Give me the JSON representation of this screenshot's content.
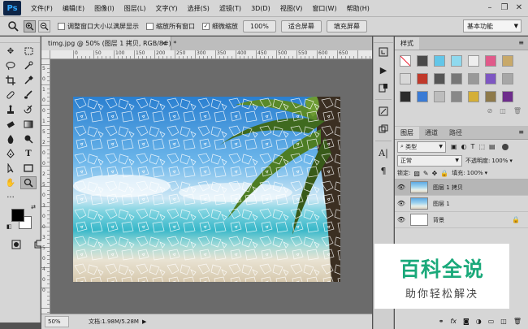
{
  "app": {
    "logo": "Ps"
  },
  "menu": [
    "文件(F)",
    "编辑(E)",
    "图像(I)",
    "图层(L)",
    "文字(Y)",
    "选择(S)",
    "滤镜(T)",
    "3D(D)",
    "视图(V)",
    "窗口(W)",
    "帮助(H)"
  ],
  "window_controls": {
    "minimize": "–",
    "restore": "❐",
    "close": "✕"
  },
  "options": {
    "resize_windows": "调整窗口大小以满屏显示",
    "resize_checked": false,
    "zoom_all": "缩放所有窗口",
    "zoom_all_checked": false,
    "scrubby": "细微缩放",
    "scrubby_checked": true,
    "percent_btn": "100%",
    "fit_screen": "适合屏幕",
    "fill_screen": "填充屏幕",
    "workspace": "基本功能"
  },
  "document": {
    "tab_title": "timg.jpg @ 50% (图层 1 拷贝, RGB/8#) *",
    "ruler_top": [
      "0",
      "50",
      "100",
      "150",
      "200",
      "250",
      "300",
      "350",
      "400",
      "450",
      "500",
      "550",
      "600",
      "650"
    ],
    "ruler_left": [
      "5",
      "0",
      "1",
      "0",
      "0",
      "1",
      "5",
      "2",
      "0",
      "0",
      "2",
      "5",
      "0",
      "3",
      "0",
      "0",
      "3",
      "5",
      "0",
      "4",
      "0",
      "0"
    ]
  },
  "status": {
    "zoom": "50%",
    "doc_size": "文档:1.98M/5.28M"
  },
  "styles_panel": {
    "tab": "样式",
    "swatch_colors": [
      "#ffffff",
      "#4a4a4a",
      "#63c6e8",
      "#8fd9ee",
      "#eeeeee",
      "#e05a8a",
      "#c8a96a",
      "#d8d8d8",
      "#c0392b",
      "#555555",
      "#777777",
      "#999999",
      "#7e57c2",
      "#a7a7a7",
      "#2c2c2c",
      "#3a7bd5",
      "#bdbdbd",
      "#888888",
      "#d4af37",
      "#8e7a4a",
      "#6e2d8c"
    ]
  },
  "layers_panel": {
    "tabs": [
      "图层",
      "通道",
      "路径"
    ],
    "kind": "类型",
    "blend": "正常",
    "opacity_label": "不透明度:",
    "opacity": "100%",
    "lock_label": "锁定:",
    "fill_label": "填充:",
    "fill": "100%",
    "layers": [
      {
        "name": "图层 1 拷贝",
        "selected": true,
        "thumb": "photo",
        "locked": false
      },
      {
        "name": "图层 1",
        "selected": false,
        "thumb": "photo",
        "locked": false
      },
      {
        "name": "背景",
        "selected": false,
        "thumb": "white",
        "locked": true
      }
    ]
  },
  "watermark": {
    "title": "百科全说",
    "subtitle": "助你轻松解决"
  }
}
